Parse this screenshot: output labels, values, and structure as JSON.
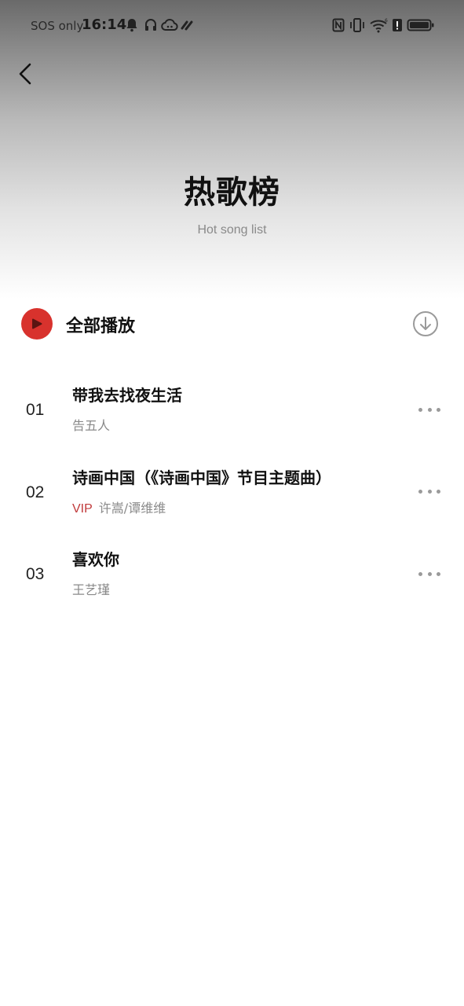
{
  "status_bar": {
    "carrier": "SOS only",
    "time": "16:14",
    "icons": [
      "bell-icon",
      "headphones-icon",
      "cloud-icon",
      "link-icon",
      "nfc-icon",
      "vibrate-icon",
      "wifi-icon",
      "alert-icon",
      "battery-icon"
    ]
  },
  "header": {
    "title": "热歌榜",
    "subtitle": "Hot song list"
  },
  "play_all": {
    "label": "全部播放"
  },
  "songs": [
    {
      "rank": "01",
      "title": "带我去找夜生活",
      "vip": "",
      "artist": "告五人"
    },
    {
      "rank": "02",
      "title": "诗画中国（《诗画中国》节目主题曲）",
      "vip": "VIP",
      "artist": "许嵩/谭维维"
    },
    {
      "rank": "03",
      "title": "喜欢你",
      "vip": "",
      "artist": "王艺瑾"
    }
  ],
  "colors": {
    "accent": "#d8322d",
    "vip": "#c0393a",
    "secondary_text": "#8a8a8a"
  }
}
